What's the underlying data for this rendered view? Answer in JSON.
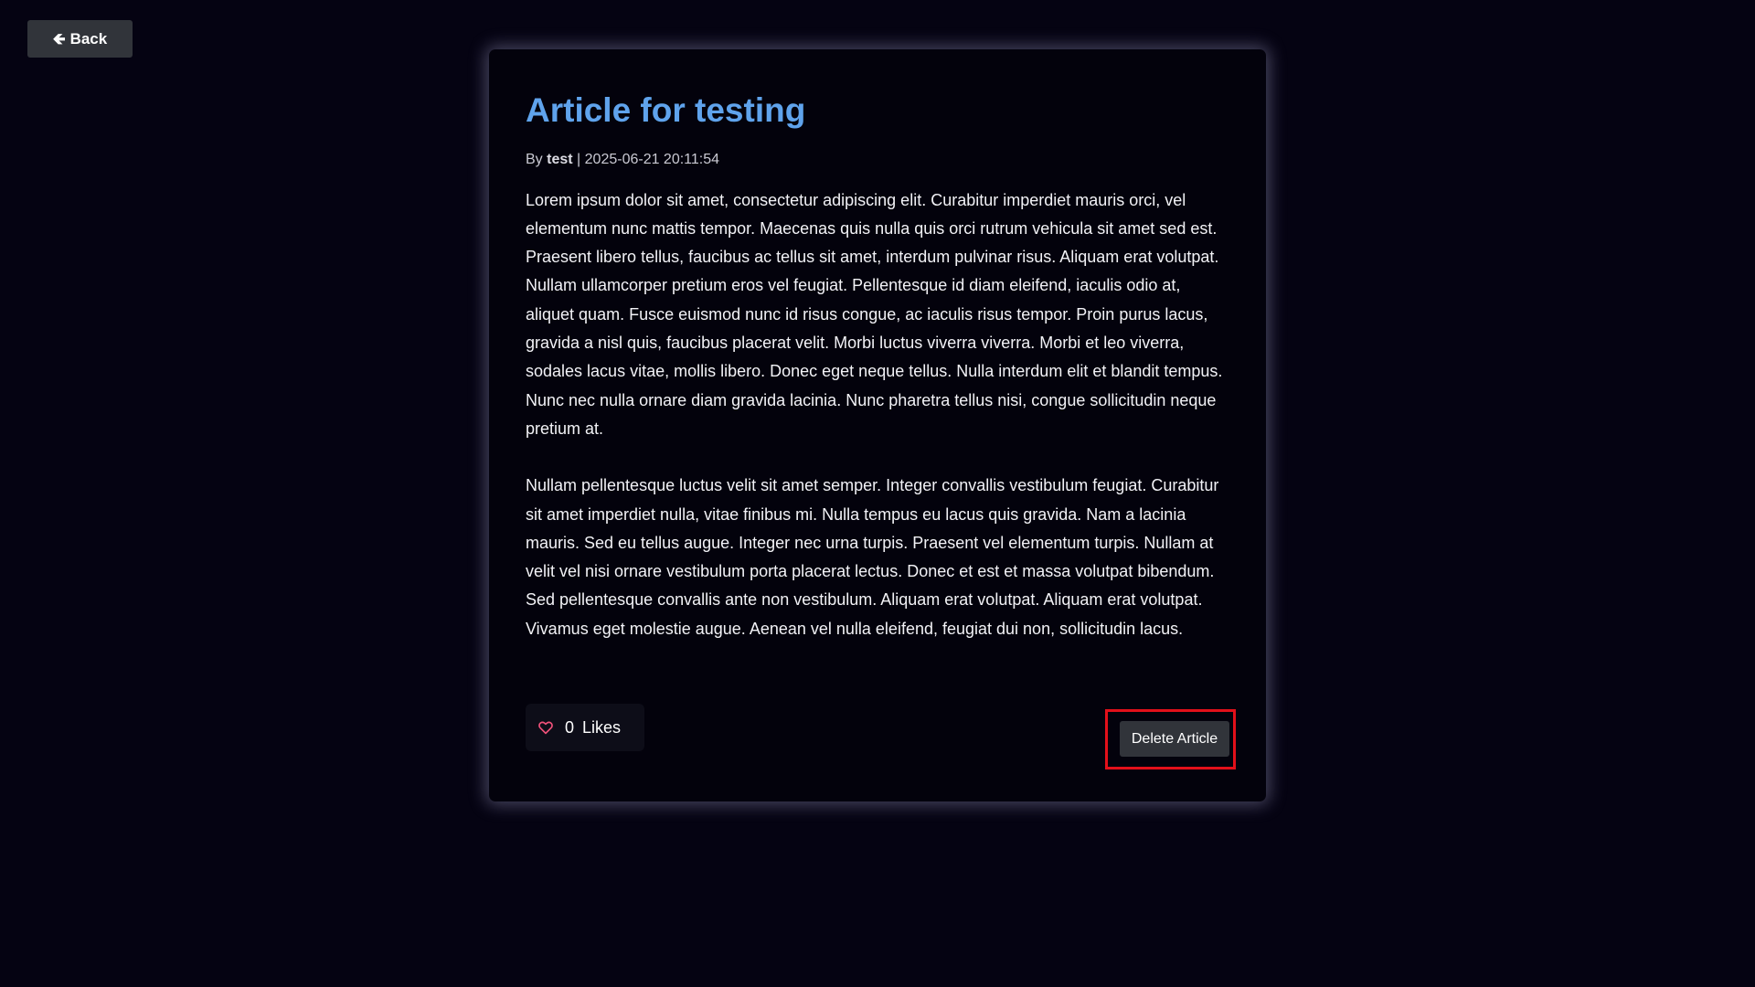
{
  "nav": {
    "back_label": "Back",
    "back_icon": "left-arrow-icon"
  },
  "article": {
    "title": "Article for testing",
    "by_label": "By",
    "author": "test",
    "separator": "|",
    "timestamp": "2025-06-21 20:11:54",
    "paragraphs": [
      "Lorem ipsum dolor sit amet, consectetur adipiscing elit. Curabitur imperdiet mauris orci, vel elementum nunc mattis tempor. Maecenas quis nulla quis orci rutrum vehicula sit amet sed est. Praesent libero tellus, faucibus ac tellus sit amet, interdum pulvinar risus. Aliquam erat volutpat. Nullam ullamcorper pretium eros vel feugiat. Pellentesque id diam eleifend, iaculis odio at, aliquet quam. Fusce euismod nunc id risus congue, ac iaculis risus tempor. Proin purus lacus, gravida a nisl quis, faucibus placerat velit. Morbi luctus viverra viverra. Morbi et leo viverra, sodales lacus vitae, mollis libero. Donec eget neque tellus. Nulla interdum elit et blandit tempus. Nunc nec nulla ornare diam gravida lacinia. Nunc pharetra tellus nisi, congue sollicitudin neque pretium at.",
      "Nullam pellentesque luctus velit sit amet semper. Integer convallis vestibulum feugiat. Curabitur sit amet imperdiet nulla, vitae finibus mi. Nulla tempus eu lacus quis gravida. Nam a lacinia mauris. Sed eu tellus augue. Integer nec urna turpis. Praesent vel elementum turpis. Nullam at velit vel nisi ornare vestibulum porta placerat lectus. Donec et est et massa volutpat bibendum. Sed pellentesque convallis ante non vestibulum. Aliquam erat volutpat. Aliquam erat volutpat. Vivamus eget molestie augue. Aenean vel nulla eleifend, feugiat dui non, sollicitudin lacus."
    ]
  },
  "likes": {
    "icon": "heart-icon",
    "count": "0",
    "label": "Likes"
  },
  "actions": {
    "delete_label": "Delete Article"
  },
  "colors": {
    "background": "#050312",
    "title": "#5fa3ec",
    "button": "#31343a",
    "heart": "#f0517a",
    "highlight": "#e3101a"
  }
}
